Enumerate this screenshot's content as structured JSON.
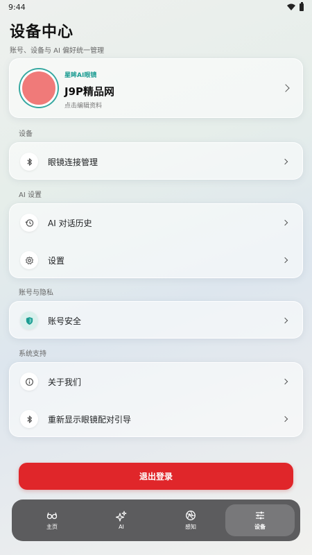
{
  "status_bar": {
    "time": "9:44"
  },
  "header": {
    "title": "设备中心",
    "subtitle": "账号、设备与 AI 偏好统一管理"
  },
  "profile": {
    "brand": "星眸AI眼镜",
    "name": "J9P精品网",
    "edit_hint": "点击编辑资料",
    "avatar_color": "#f07a79",
    "ring_color": "#36a8a0"
  },
  "sections": {
    "device": {
      "label": "设备",
      "items": [
        {
          "label": "眼镜连接管理",
          "icon": "bluetooth-icon"
        }
      ]
    },
    "ai": {
      "label": "AI 设置",
      "items": [
        {
          "label": "AI 对话历史",
          "icon": "history-icon"
        },
        {
          "label": "设置",
          "icon": "gear-icon"
        }
      ]
    },
    "privacy": {
      "label": "账号与隐私",
      "items": [
        {
          "label": "账号安全",
          "icon": "shield-icon"
        }
      ]
    },
    "support": {
      "label": "系统支持",
      "items": [
        {
          "label": "关于我们",
          "icon": "info-icon"
        },
        {
          "label": "重新显示眼镜配对引导",
          "icon": "bluetooth-icon"
        }
      ]
    }
  },
  "logout": {
    "label": "退出登录",
    "color": "#e0262a"
  },
  "tabs": [
    {
      "label": "主页",
      "icon": "glasses-icon",
      "active": false
    },
    {
      "label": "AI",
      "icon": "sparkle-icon",
      "active": false
    },
    {
      "label": "感知",
      "icon": "aperture-icon",
      "active": false
    },
    {
      "label": "设备",
      "icon": "sliders-icon",
      "active": true
    }
  ]
}
